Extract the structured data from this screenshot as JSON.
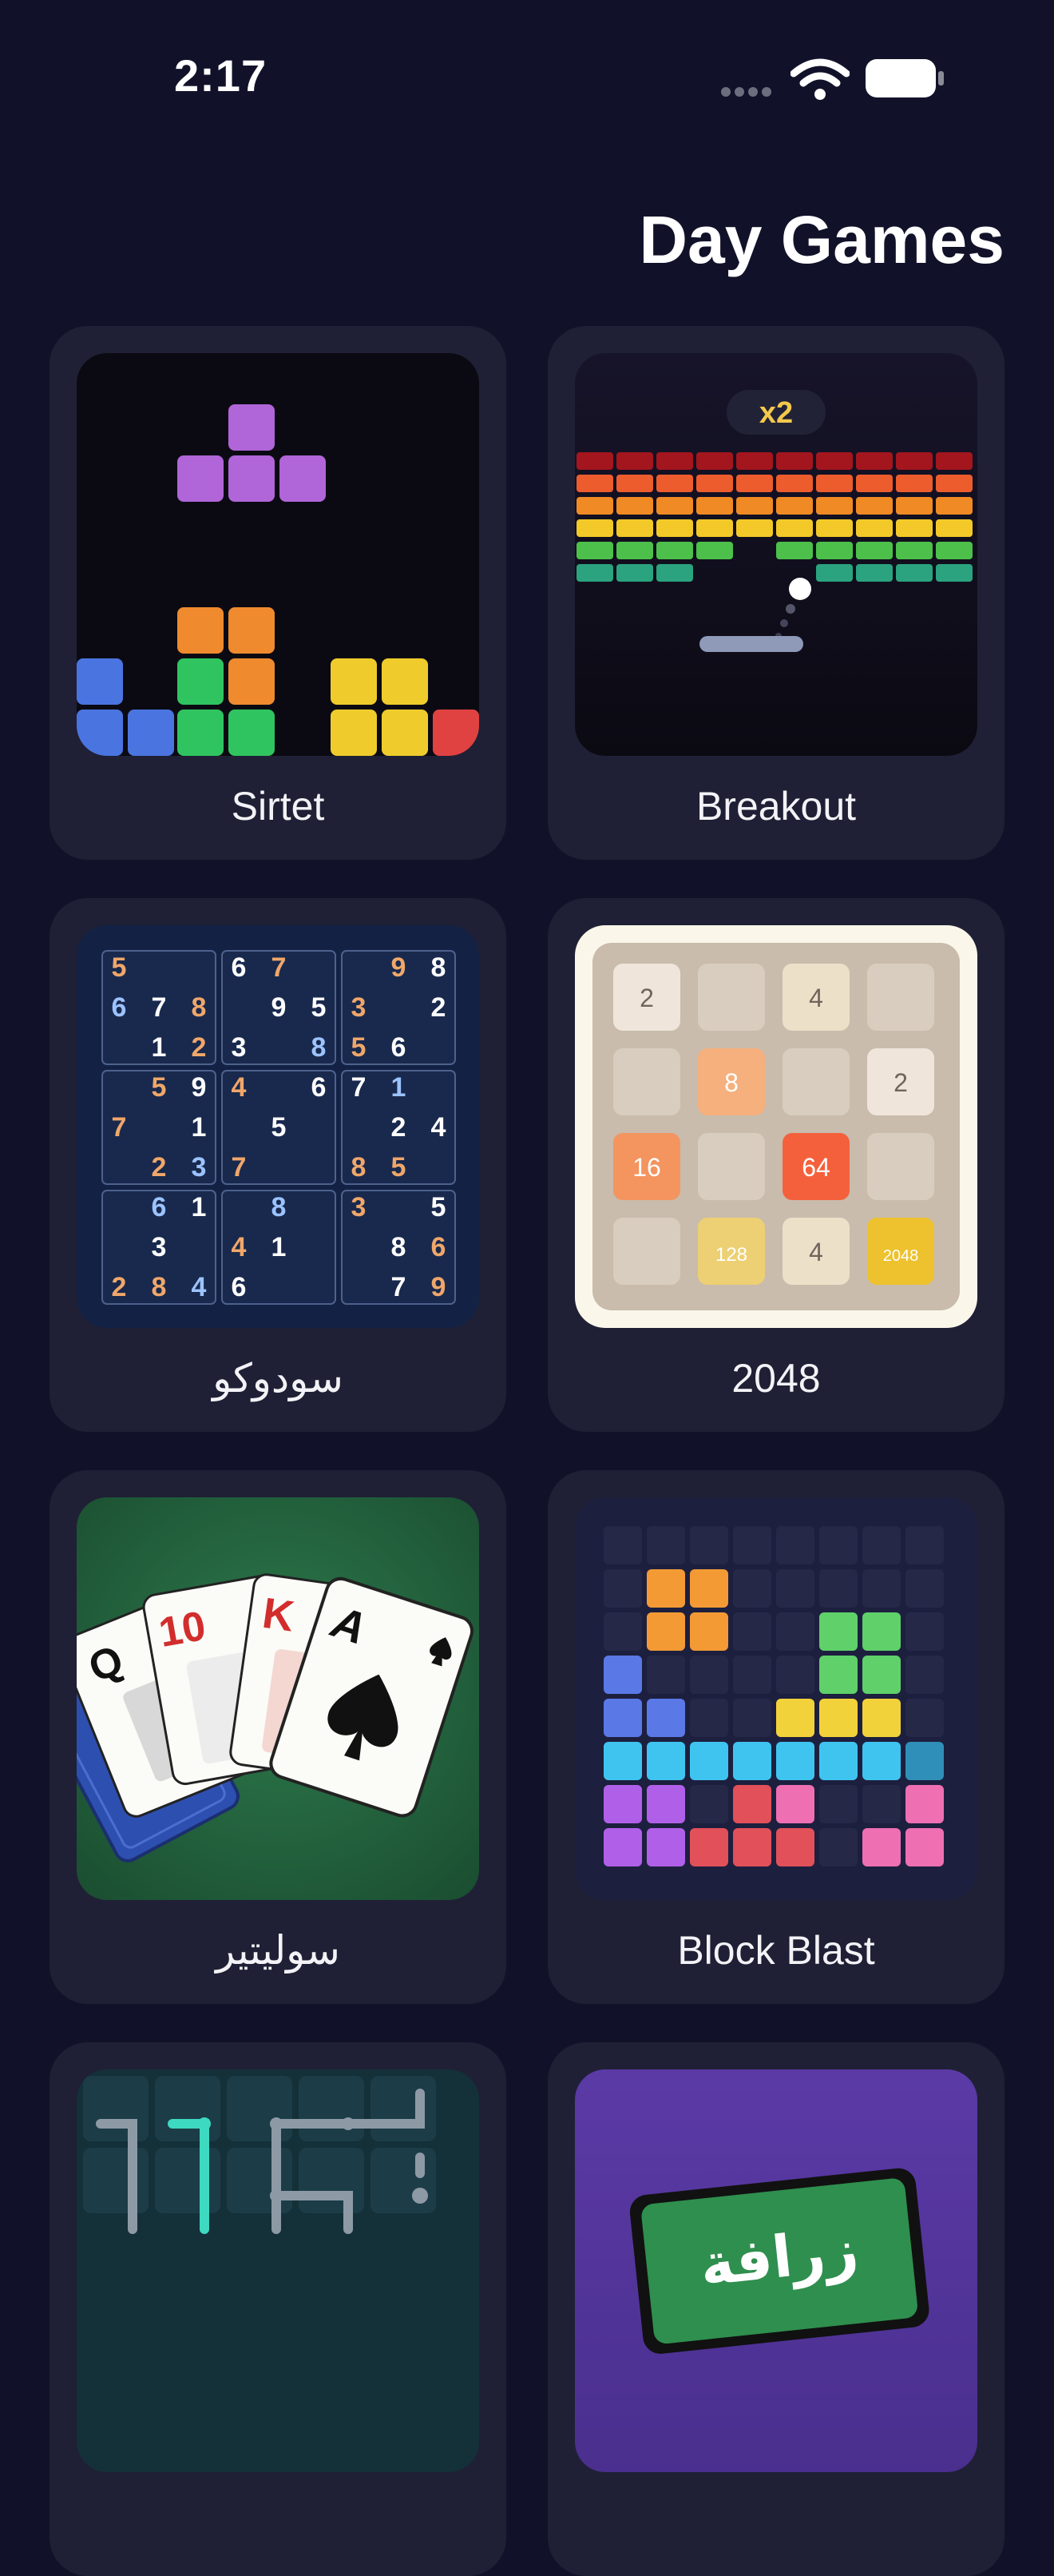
{
  "status": {
    "time": "2:17"
  },
  "header": {
    "title": "Day Games"
  },
  "games": [
    {
      "label": "Sirtet"
    },
    {
      "label": "Breakout",
      "badge": "x2"
    },
    {
      "label": "سودوكو"
    },
    {
      "label": "2048"
    },
    {
      "label": "سوليتير",
      "cards": [
        "Q",
        "10",
        "K",
        "A"
      ]
    },
    {
      "label": "Block Blast"
    },
    {
      "label": ""
    },
    {
      "label": "",
      "thumb_text": "زرافة"
    }
  ],
  "sudoku_digits": [
    [
      "5",
      "",
      "",
      "6",
      "7",
      "",
      "",
      "9",
      "8"
    ],
    [
      "6",
      "7",
      "8",
      "",
      "9",
      "5",
      "3",
      "",
      "2"
    ],
    [
      "",
      "1",
      "2",
      "3",
      "",
      "8",
      "5",
      "6",
      ""
    ],
    [
      "",
      "5",
      "9",
      "4",
      "",
      "6",
      "7",
      "1",
      ""
    ],
    [
      "7",
      "",
      "1",
      "",
      "5",
      "",
      "",
      "2",
      "4"
    ],
    [
      "",
      "2",
      "3",
      "7",
      "",
      "",
      "8",
      "5",
      ""
    ],
    [
      "",
      "6",
      "1",
      "",
      "8",
      "",
      "3",
      "",
      "5"
    ],
    [
      "",
      "3",
      "",
      "4",
      "1",
      "",
      "",
      "8",
      "6"
    ],
    [
      "2",
      "8",
      "4",
      "6",
      "",
      "",
      "",
      "7",
      "9"
    ]
  ],
  "tiles_2048": [
    [
      "2",
      "",
      "4",
      ""
    ],
    [
      "",
      "8",
      "",
      "2"
    ],
    [
      "16",
      "",
      "64",
      ""
    ],
    [
      "",
      "128",
      "4",
      "2048"
    ]
  ],
  "colors": {
    "background": "#11122a",
    "card": "#1f2035",
    "accent_yellow": "#f2c94c"
  }
}
